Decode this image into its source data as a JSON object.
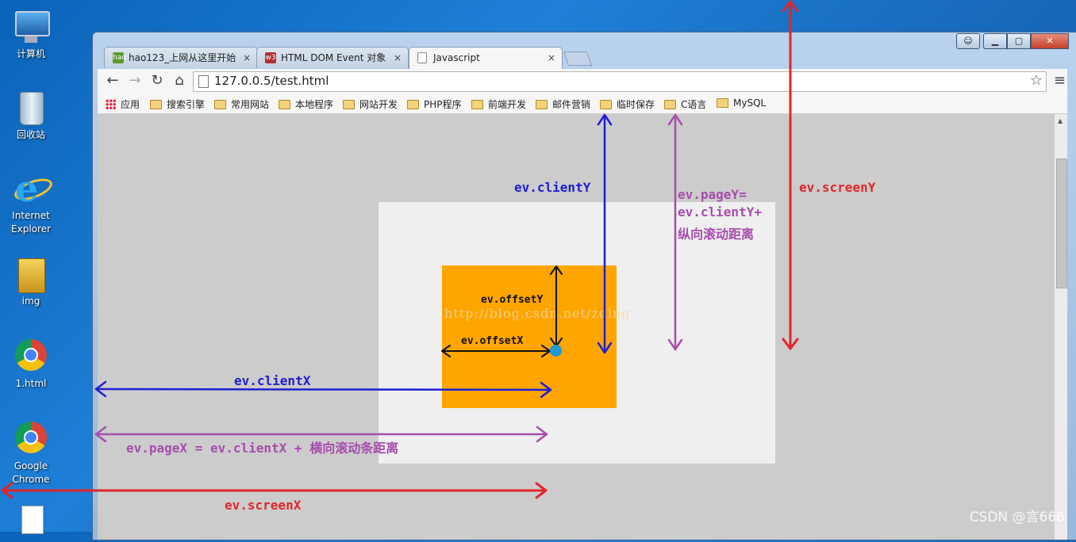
{
  "desktop": {
    "icons": [
      {
        "label": "计算机",
        "icon": "computer-icon"
      },
      {
        "label": "回收站",
        "icon": "recycle-bin-icon"
      },
      {
        "label": "Internet Explorer",
        "icon": "ie-icon"
      },
      {
        "label": "img",
        "icon": "folder-icon"
      },
      {
        "label": "1.html",
        "icon": "chrome-icon"
      },
      {
        "label": "Google Chrome",
        "icon": "chrome-icon"
      }
    ]
  },
  "browser": {
    "tabs": [
      {
        "label": "hao123_上网从这里开始",
        "close": "×",
        "icon_text": "hao"
      },
      {
        "label": "HTML DOM Event 对象",
        "close": "×",
        "icon_text": "w3"
      },
      {
        "label": "Javascript",
        "close": "×",
        "icon_text": ""
      }
    ],
    "url": "127.0.0.5/test.html",
    "bookmarks": [
      "应用",
      "搜索引擎",
      "常用网站",
      "本地程序",
      "网站开发",
      "PHP程序",
      "前端开发",
      "邮件营销",
      "临时保存",
      "C语言",
      "MySQL"
    ]
  },
  "diagram": {
    "client_y": "ev.clientY",
    "page_y_line1": "ev.pageY=",
    "page_y_line2": "ev.clientY+",
    "page_y_line3": "纵向滚动距离",
    "screen_y": "ev.screenY",
    "offset_y": "ev.offsetY",
    "offset_x": "ev.offsetX",
    "client_x": "ev.clientX",
    "page_x": "ev.pageX = ev.clientX + 横向滚动条距离",
    "screen_x": "ev.screenX",
    "watermark": "http://blog.csdn.net/zding"
  },
  "colors": {
    "blue": "#1f1fd1",
    "purple": "#a64dac",
    "red": "#e0262b",
    "orange_box": "#ffa500",
    "dot": "#1e98d6"
  },
  "footer": {
    "watermark": "CSDN @言666"
  }
}
